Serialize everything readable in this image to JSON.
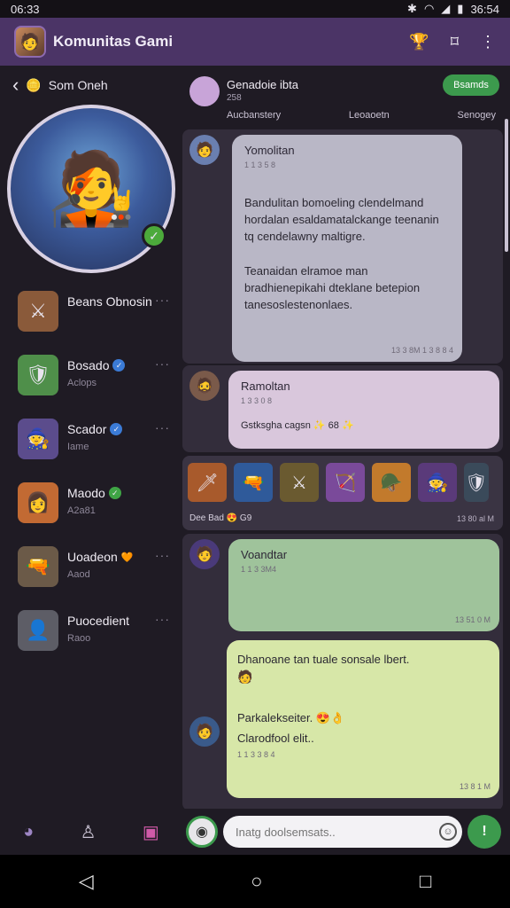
{
  "status_bar": {
    "time": "06:33",
    "right": "36:54"
  },
  "app_bar": {
    "title": "Komunitas Gami",
    "actions": [
      "trophy-icon",
      "bookmark-icon",
      "more-icon"
    ]
  },
  "left_panel": {
    "back_label": "Som Oneh",
    "contacts": [
      {
        "name": "Beans Obnosin",
        "sub": "",
        "badge": "",
        "color": "#8a5a3a"
      },
      {
        "name": "Bosado",
        "sub": "Aclops",
        "badge": "blue",
        "color": "#4f8f4a"
      },
      {
        "name": "Scador",
        "sub": "Iame",
        "badge": "blue",
        "color": "#5b4c8c"
      },
      {
        "name": "Maodo",
        "sub": "A2a81",
        "badge": "green",
        "color": "#c26a33"
      },
      {
        "name": "Uoadeon",
        "sub": "Aaod",
        "badge": "heart",
        "color": "#6b5a48"
      },
      {
        "name": "Puocedient",
        "sub": "Raoo",
        "badge": "",
        "color": "#5d5d66"
      }
    ]
  },
  "chat": {
    "group_name": "Genadoie ibta",
    "group_sub": "258",
    "join_label": "Bsamds",
    "tabs": [
      "Aucbanstery",
      "Leoaoetn",
      "Senogey"
    ],
    "messages": [
      {
        "name": "Yomolitan",
        "time": "1 1 3 5 8",
        "para1": "Bandulitan bomoeling clendelmand hordalan esaldamatalckange teenanin tq cendelawny maltigre.",
        "para2": "Teanaidan elramoe man bradhienepikahi dteklane betepion tanesoslestenonlaes.",
        "foot": "13 3 8M   1 3 8 8 4"
      },
      {
        "name": "Ramoltan",
        "time": "1 3 3 0 8",
        "line": "Gstksgha cagsn  ✨  68  ✨",
        "foot": ""
      },
      {
        "tiles_caption": "Dee Bad  😍  G9",
        "foot": "13 80 al M"
      },
      {
        "name": "Voandtar",
        "time": "1 1 3 3M4",
        "foot": "13 51 0 M"
      },
      {
        "line1": "Dhanoane tan tuale sonsale lbert.",
        "line2": "Parkalekseiter. 😍👌",
        "line3": "Clarodfool elit..",
        "time": "1 1 3 3 8 4",
        "foot": "13 8 1 M"
      }
    ]
  },
  "composer": {
    "placeholder": "Inatg doolsemsats.."
  },
  "bottom_tabs": [
    "home-icon",
    "profile-icon",
    "chat-icon"
  ]
}
